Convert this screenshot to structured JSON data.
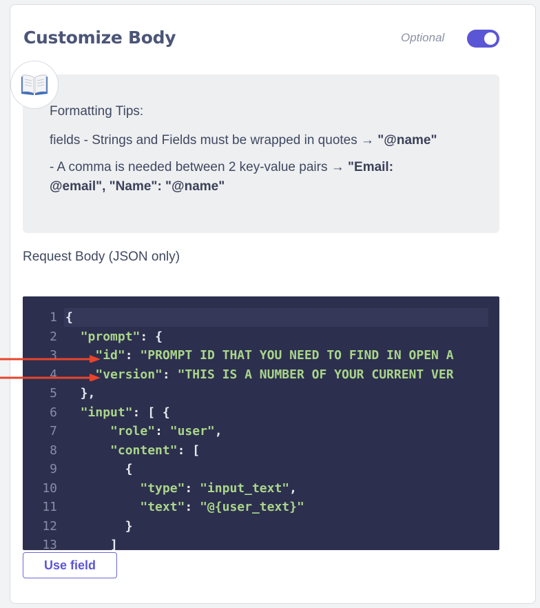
{
  "section": {
    "title": "Customize Body",
    "optional_label": "Optional",
    "toggle_on": true
  },
  "tips": {
    "heading": "Formatting Tips:",
    "line1_text": "fields - Strings and Fields must be wrapped in quotes → ",
    "line1_bold": "\"@name\"",
    "line2_text": "- A comma is needed between 2 key-value pairs → ",
    "line2_bold": "\"Email: @email\", \"Name\": \"@name\"",
    "icon": "book-icon"
  },
  "request": {
    "label": "Request Body (JSON only)",
    "lines": [
      {
        "n": "1",
        "text": "{"
      },
      {
        "n": "2",
        "text": "  \"prompt\": {"
      },
      {
        "n": "3",
        "text": "    \"id\": \"PROMPT ID THAT YOU NEED TO FIND IN OPEN A"
      },
      {
        "n": "4",
        "text": "    \"version\": \"THIS IS A NUMBER OF YOUR CURRENT VER"
      },
      {
        "n": "5",
        "text": "  },"
      },
      {
        "n": "6",
        "text": "  \"input\": [ {"
      },
      {
        "n": "7",
        "text": "      \"role\": \"user\","
      },
      {
        "n": "8",
        "text": "      \"content\": ["
      },
      {
        "n": "9",
        "text": "        {"
      },
      {
        "n": "10",
        "text": "          \"type\": \"input_text\","
      },
      {
        "n": "11",
        "text": "          \"text\": \"@{user_text}\""
      },
      {
        "n": "12",
        "text": "        }"
      },
      {
        "n": "13",
        "text": "      ]"
      }
    ]
  },
  "use_field_label": "Use field",
  "colors": {
    "accent": "#5b56d6",
    "editor_bg": "#2d2f4e",
    "code_string": "#a9d68a",
    "annotation_arrow": "#e8452c"
  }
}
